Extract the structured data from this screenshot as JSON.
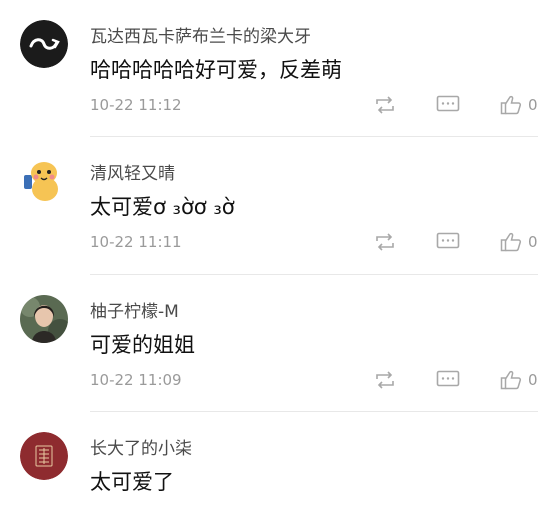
{
  "comments": [
    {
      "username": "瓦达西瓦卡萨布兰卡的梁大牙",
      "text": "哈哈哈哈哈好可爱，反差萌",
      "time": "10-22 11:12",
      "likes": "0",
      "avatar_icon": "black-circle-logo-avatar"
    },
    {
      "username": "清风轻又晴",
      "text": "太可爱ơ ₃ờơ ₃ờ",
      "time": "10-22 11:11",
      "likes": "0",
      "avatar_icon": "cartoon-character-avatar"
    },
    {
      "username": "柚子柠檬-M",
      "text": "可爱的姐姐",
      "time": "10-22 11:09",
      "likes": "0",
      "avatar_icon": "photo-avatar"
    },
    {
      "username": "长大了的小柒",
      "text": "太可爱了",
      "avatar_icon": "red-seal-avatar"
    }
  ],
  "icons": {
    "repost": "repost-icon",
    "reply": "comment-icon",
    "like": "thumbs-up-icon"
  },
  "colors": {
    "meta_text": "#9a9a9a",
    "icon_stroke": "#a8a8a8",
    "divider": "#e8e8e8"
  }
}
